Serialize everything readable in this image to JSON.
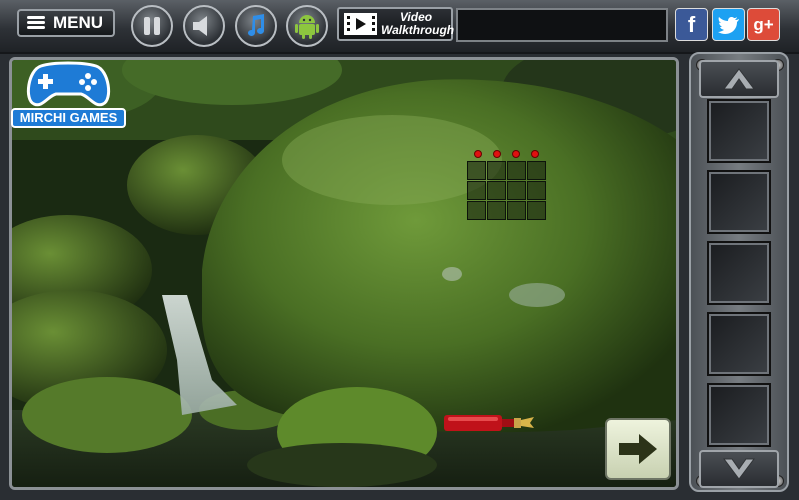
{
  "toolbar": {
    "menu_label": "MENU",
    "walkthrough_line1": "Video",
    "walkthrough_line2": "Walkthrough",
    "social": {
      "facebook": "f",
      "twitter": "t",
      "googleplus": "g+"
    }
  },
  "logo": {
    "text": "MIRCHI GAMES"
  },
  "colors": {
    "logo_blue": "#1e7bd6",
    "moss_green": "#4f7a1e",
    "android_green": "#8dc63f",
    "facebook": "#3b5998",
    "twitter": "#1da1f2",
    "googleplus": "#dd4b39",
    "puzzle_dot": "#e01010",
    "bottle_red": "#c0121a"
  },
  "icons": [
    "menu-icon",
    "pause-icon",
    "speaker-icon",
    "music-note-icon",
    "android-icon",
    "film-icon",
    "arrow-up-icon",
    "arrow-down-icon",
    "arrow-right-icon",
    "gamepad-icon"
  ],
  "inventory": {
    "slots": 5
  }
}
